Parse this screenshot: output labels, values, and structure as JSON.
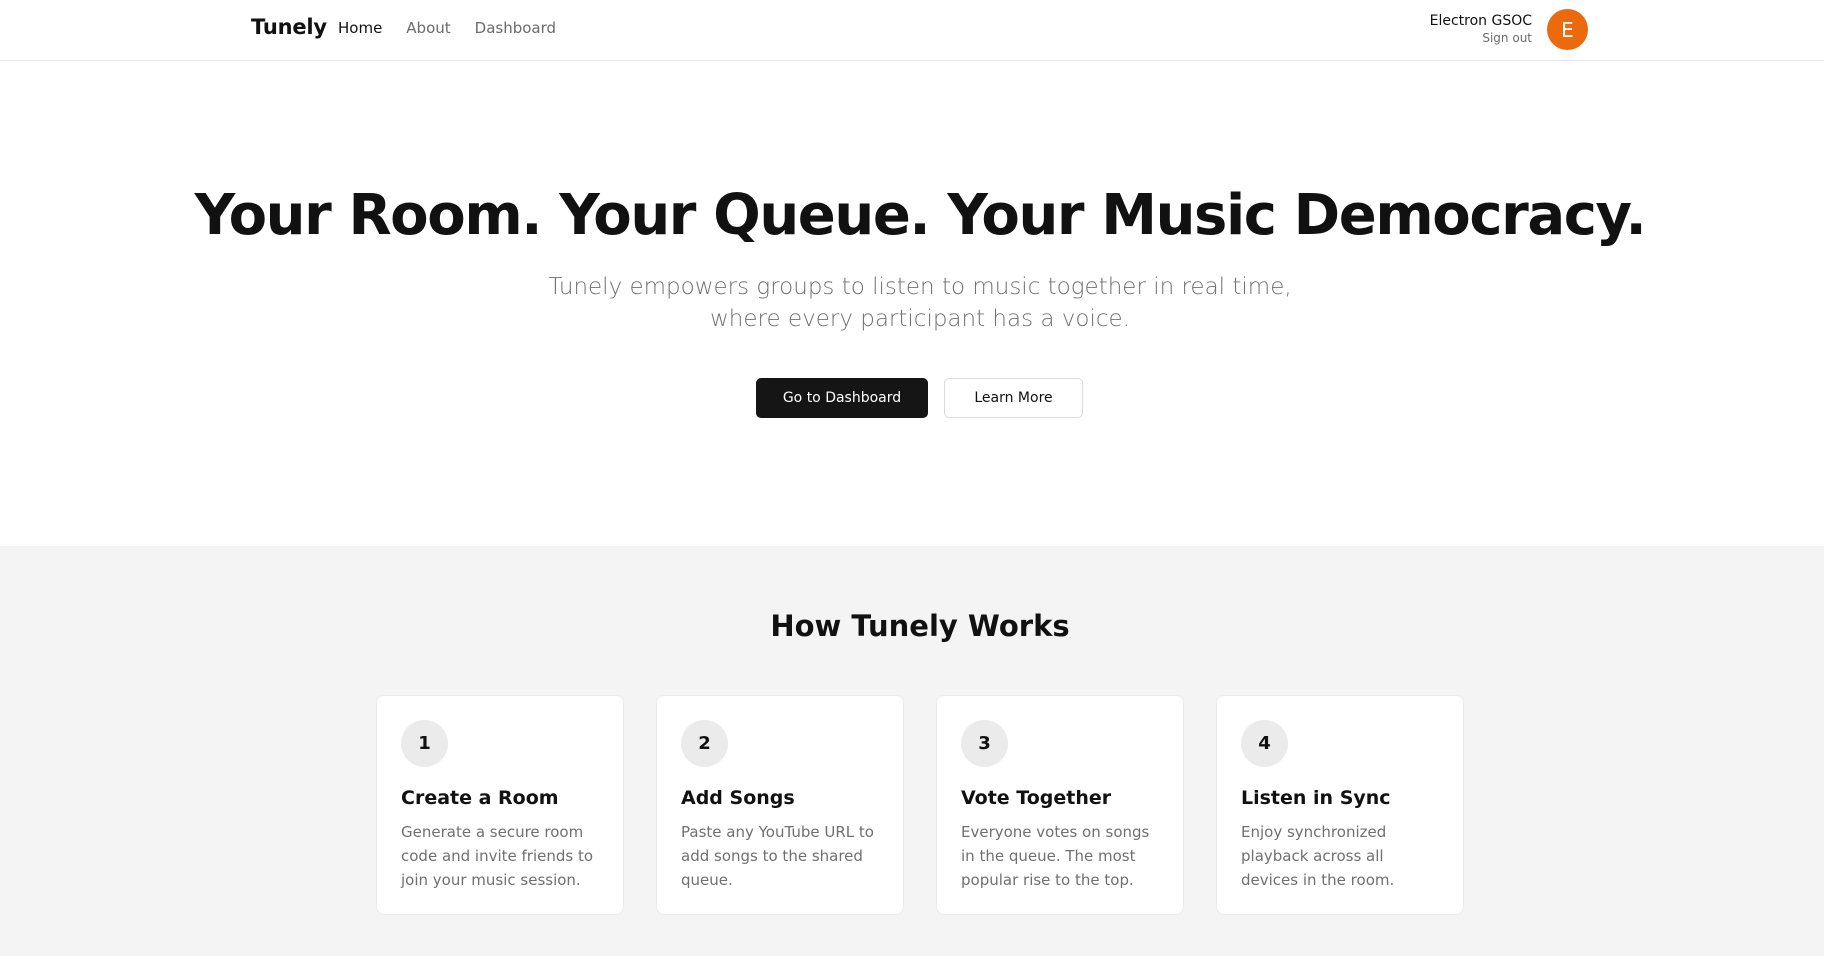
{
  "header": {
    "brand": "Tunely",
    "nav": [
      {
        "label": "Home",
        "active": true
      },
      {
        "label": "About",
        "active": false
      },
      {
        "label": "Dashboard",
        "active": false
      }
    ],
    "user": {
      "name": "Electron GSOC",
      "sign_out": "Sign out",
      "avatar_initial": "E",
      "avatar_color": "#ea6a0d"
    }
  },
  "hero": {
    "title": "Your Room. Your Queue. Your Music Democracy.",
    "subtitle": "Tunely empowers groups to listen to music together in real time, where every participant has a voice.",
    "primary_button": "Go to Dashboard",
    "secondary_button": "Learn More"
  },
  "how": {
    "title": "How Tunely Works",
    "steps": [
      {
        "number": "1",
        "title": "Create a Room",
        "description": "Generate a secure room code and invite friends to join your music session."
      },
      {
        "number": "2",
        "title": "Add Songs",
        "description": "Paste any YouTube URL to add songs to the shared queue."
      },
      {
        "number": "3",
        "title": "Vote Together",
        "description": "Everyone votes on songs in the queue. The most popular rise to the top."
      },
      {
        "number": "4",
        "title": "Listen in Sync",
        "description": "Enjoy synchronized playback across all devices in the room."
      }
    ]
  }
}
